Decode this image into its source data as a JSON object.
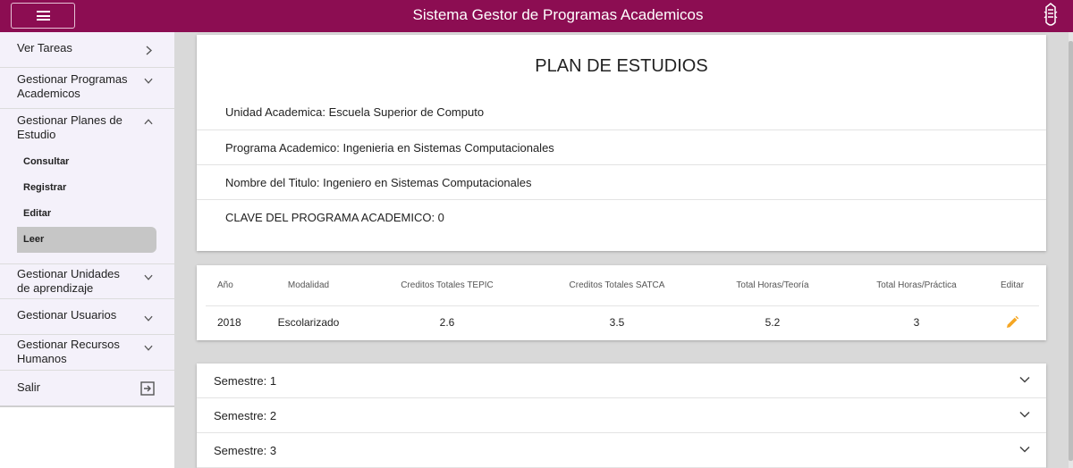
{
  "header": {
    "title": "Sistema Gestor de Programas Academicos",
    "menu_icon": "hamburger-icon",
    "logo_icon": "institution-logo",
    "bar_color": "#8c0d52"
  },
  "sidebar": {
    "items": [
      {
        "label": "Ver Tareas",
        "icon": "chevron-right-icon"
      },
      {
        "label": "Gestionar Programas Academicos",
        "icon": "chevron-down-icon"
      },
      {
        "label": "Gestionar Planes de Estudio",
        "icon": "chevron-up-icon",
        "sub_items": [
          "Consultar",
          "Registrar",
          "Editar",
          "Leer"
        ],
        "active_sub": "Leer"
      },
      {
        "label": "Gestionar Unidades de aprendizaje",
        "icon": "chevron-down-icon"
      },
      {
        "label": "Gestionar Usuarios",
        "icon": "chevron-down-icon"
      },
      {
        "label": "Gestionar Recursos Humanos",
        "icon": "chevron-down-icon"
      },
      {
        "label": "Salir",
        "icon": "exit-icon"
      }
    ]
  },
  "plan": {
    "title": "PLAN DE ESTUDIOS",
    "unidad": "Unidad Academica: Escuela Superior de Computo",
    "programa": "Programa Academico: Ingenieria en Sistemas Computacionales",
    "titulo": "Nombre del Titulo: Ingeniero en Sistemas Computacionales",
    "clave": "CLAVE DEL PROGRAMA ACADEMICO: 0"
  },
  "table": {
    "headers": [
      "Año",
      "Modalidad",
      "Creditos Totales TEPIC",
      "Creditos Totales SATCA",
      "Total Horas/Teoría",
      "Total Horas/Práctica",
      "Editar"
    ],
    "rows": [
      {
        "anio": "2018",
        "modalidad": "Escolarizado",
        "tepic": "2.6",
        "satca": "3.5",
        "teoria": "5.2",
        "practica": "3",
        "edit_icon": "pencil-icon"
      }
    ],
    "edit_color": "#f5a623"
  },
  "semesters": [
    "Semestre: 1",
    "Semestre: 2",
    "Semestre: 3"
  ]
}
